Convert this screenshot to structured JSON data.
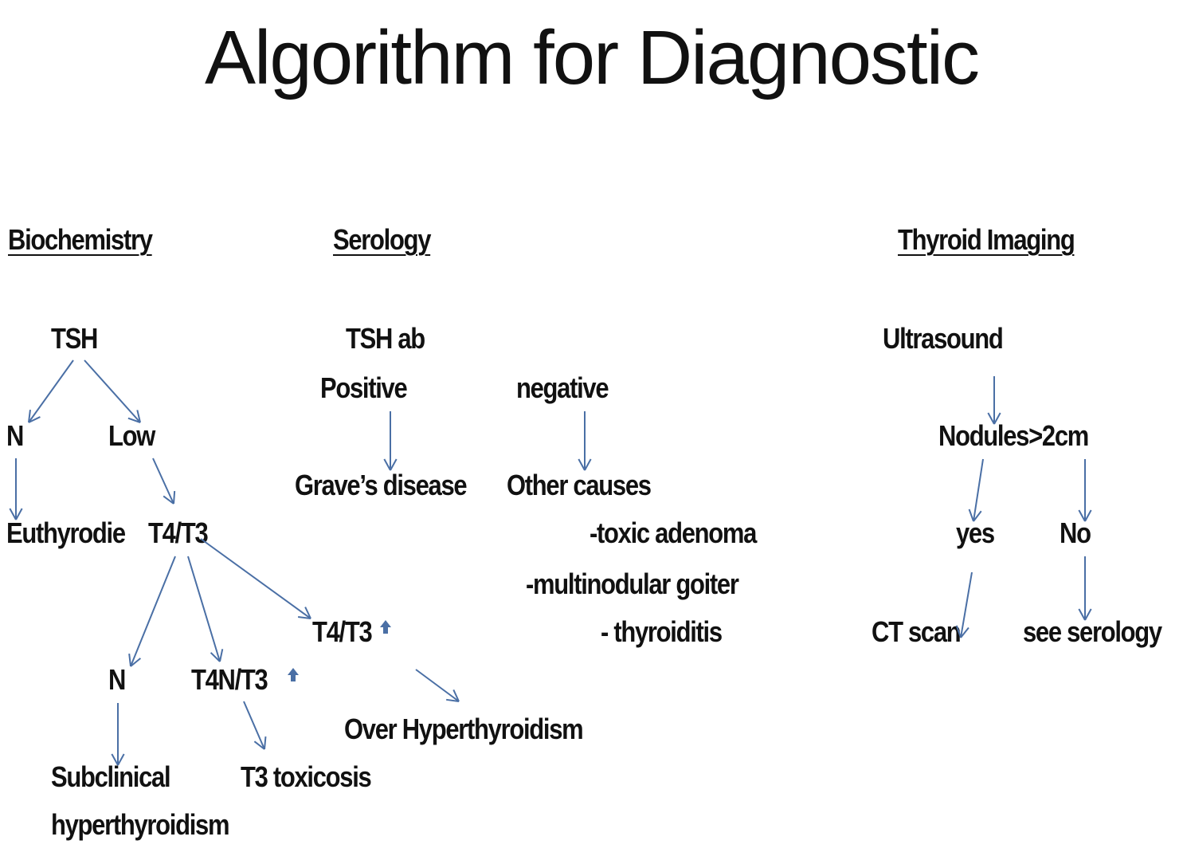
{
  "title": "Algorithm for Diagnostic",
  "colors": {
    "arrow": "#4a6fa5",
    "text": "#111111",
    "background": "#ffffff"
  },
  "headers": {
    "biochemistry": "Biochemistry",
    "serology": "Serology",
    "imaging": "Thyroid Imaging"
  },
  "biochemistry": {
    "tsh": "TSH",
    "n": "N",
    "low": "Low",
    "euthyrodie": "Euthyrodie",
    "t4t3": "T4/T3",
    "t4t3_up": "T4/T3",
    "n2": "N",
    "t4n_t3_up": "T4N/T3",
    "subclinical_line1": "Subclinical",
    "subclinical_line2": "hyperthyroidism",
    "t3_toxicosis": "T3 toxicosis",
    "over_hyperthyroidism": "Over Hyperthyroidism"
  },
  "serology": {
    "tsh_ab": "TSH ab",
    "positive": "Positive",
    "negative": "negative",
    "graves": "Grave’s disease",
    "other_causes": "Other causes",
    "cause_1": "-toxic adenoma",
    "cause_2": "-multinodular goiter",
    "cause_3": "- thyroiditis"
  },
  "imaging": {
    "ultrasound": "Ultrasound",
    "nodules": "Nodules>2cm",
    "yes": "yes",
    "no": "No",
    "ct_scan": "CT scan",
    "see_serology": "see serology"
  }
}
